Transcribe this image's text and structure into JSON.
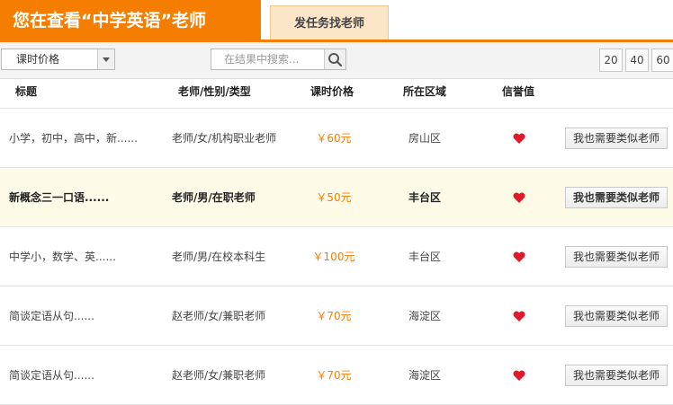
{
  "header": {
    "title": "您在查看“中学英语”老师",
    "post_task_label": "发任务找老师"
  },
  "toolbar": {
    "sort_select_value": "课时价格",
    "search_placeholder": "在结果中搜索...",
    "page_sizes": [
      "20",
      "40",
      "60"
    ]
  },
  "table": {
    "columns": [
      "标题",
      "老师/性别/类型",
      "课时价格",
      "所在区域",
      "信誉值"
    ],
    "action_label": "我也需要类似老师",
    "rows": [
      {
        "title": "小学，初中，高中，新......",
        "teacher": "老师/女/机构职业老师",
        "price": "￥60元",
        "area": "房山区",
        "highlight": false
      },
      {
        "title": "新概念三一口语......",
        "teacher": "老师/男/在职老师",
        "price": "￥50元",
        "area": "丰台区",
        "highlight": true
      },
      {
        "title": "中学小，数学、英......",
        "teacher": "老师/男/在校本科生",
        "price": "￥100元",
        "area": "丰台区",
        "highlight": false
      },
      {
        "title": "简谈定语从句......",
        "teacher": "赵老师/女/兼职老师",
        "price": "￥70元",
        "area": "海淀区",
        "highlight": false
      },
      {
        "title": "简谈定语从句......",
        "teacher": "赵老师/女/兼职老师",
        "price": "￥70元",
        "area": "海淀区",
        "highlight": false
      }
    ]
  },
  "colors": {
    "accent": "#f57e00",
    "heart": "#e0192b",
    "highlight_row": "#fdfbe8"
  },
  "icons": {
    "search": "search-icon",
    "dropdown": "chevron-down-icon",
    "reputation": "heart-icon"
  }
}
